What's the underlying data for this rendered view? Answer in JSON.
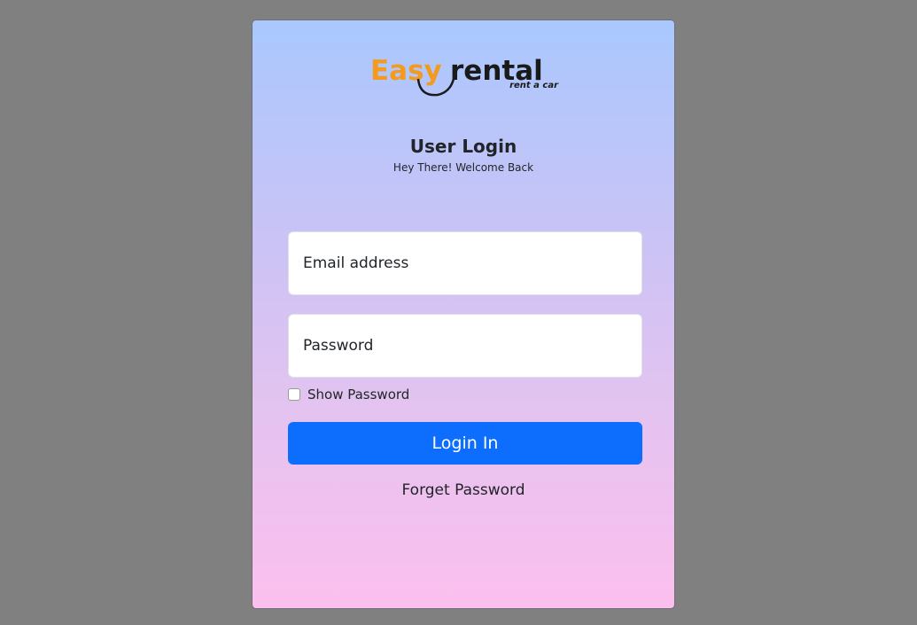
{
  "logo": {
    "brand_part1": "Easy",
    "brand_part2": "rental",
    "tagline": "rent a car",
    "colors": {
      "orange": "#f39a1f",
      "dark": "#1a1a1a"
    }
  },
  "login": {
    "title": "User Login",
    "subtitle": "Hey There! Welcome Back",
    "email_placeholder": "Email address",
    "password_placeholder": "Password",
    "show_password_label": "Show Password",
    "show_password_checked": false,
    "submit_label": "Login In",
    "forget_label": "Forget Password"
  },
  "colors": {
    "page_bg": "#808080",
    "gradient_top": "#a9c8fe",
    "gradient_bottom": "#fcbfee",
    "primary": "#0d6efd"
  }
}
